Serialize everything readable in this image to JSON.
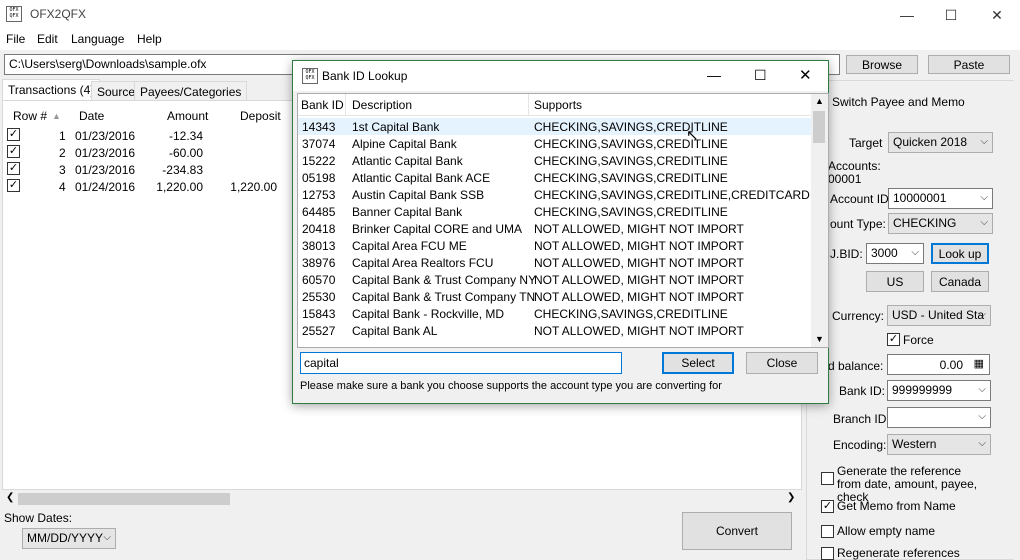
{
  "app": {
    "title": "OFX2QFX",
    "minimize": "—",
    "maximize": "☐",
    "close": "✕"
  },
  "menu": [
    "File",
    "Edit",
    "Language",
    "Help"
  ],
  "path": "C:\\Users\\serg\\Downloads\\sample.ofx",
  "toolbar": {
    "browse": "Browse",
    "paste": "Paste"
  },
  "tabs": [
    "Transactions (4)",
    "Source",
    "Payees/Categories"
  ],
  "grid": {
    "headers": [
      "Row #",
      "Date",
      "Amount",
      "Deposit"
    ],
    "rows": [
      {
        "num": "1",
        "date": "01/23/2016",
        "amount": "-12.34",
        "deposit": ""
      },
      {
        "num": "2",
        "date": "01/23/2016",
        "amount": "-60.00",
        "deposit": ""
      },
      {
        "num": "3",
        "date": "01/23/2016",
        "amount": "-234.83",
        "deposit": ""
      },
      {
        "num": "4",
        "date": "01/24/2016",
        "amount": "1,220.00",
        "deposit": "1,220.00"
      }
    ]
  },
  "bottom": {
    "show_dates_label": "Show Dates:",
    "date_format": "MM/DD/YYYY",
    "convert": "Convert"
  },
  "right": {
    "switch_payee": "Switch Payee and Memo",
    "target_label": "Target",
    "target_value": "Quicken 2018",
    "accounts_label": "Accounts:",
    "accounts_value": "00001",
    "account_id_label": "Account ID:",
    "account_id_value": "10000001",
    "account_type_label": "ount Type:",
    "account_type_value": "CHECKING",
    "intubid_label": "J.BID:",
    "intubid_value": "3000",
    "lookup": "Look up",
    "us": "US",
    "canada": "Canada",
    "currency_label": "Currency:",
    "currency_value": "USD - United Sta",
    "force": "Force",
    "end_balance_label": "d balance:",
    "end_balance_value": "0.00",
    "bank_id_label": "Bank ID:",
    "bank_id_value": "999999999",
    "branch_id_label": "Branch ID",
    "branch_id_value": "",
    "encoding_label": "Encoding:",
    "encoding_value": "Western",
    "gen_ref": "Generate the reference from date, amount, payee, check",
    "get_memo": "Get Memo from Name",
    "allow_empty": "Allow empty name",
    "regen_ref": "Regenerate references"
  },
  "dialog": {
    "title": "Bank ID Lookup",
    "headers": [
      "Bank ID",
      "Description",
      "Supports"
    ],
    "rows": [
      {
        "id": "14343",
        "desc": "1st Capital Bank",
        "supports": "CHECKING,SAVINGS,CREDITLINE"
      },
      {
        "id": "37074",
        "desc": "Alpine Capital Bank",
        "supports": "CHECKING,SAVINGS,CREDITLINE"
      },
      {
        "id": "15222",
        "desc": "Atlantic Capital Bank",
        "supports": "CHECKING,SAVINGS,CREDITLINE"
      },
      {
        "id": "05198",
        "desc": "Atlantic Capital Bank ACE",
        "supports": "CHECKING,SAVINGS,CREDITLINE"
      },
      {
        "id": "12753",
        "desc": "Austin Capital Bank SSB",
        "supports": "CHECKING,SAVINGS,CREDITLINE,CREDITCARD"
      },
      {
        "id": "64485",
        "desc": "Banner Capital Bank",
        "supports": "CHECKING,SAVINGS,CREDITLINE"
      },
      {
        "id": "20418",
        "desc": "Brinker Capital CORE and UMA",
        "supports": "NOT ALLOWED, MIGHT NOT IMPORT"
      },
      {
        "id": "38013",
        "desc": "Capital Area FCU ME",
        "supports": "NOT ALLOWED, MIGHT NOT IMPORT"
      },
      {
        "id": "38976",
        "desc": "Capital Area Realtors FCU",
        "supports": "NOT ALLOWED, MIGHT NOT IMPORT"
      },
      {
        "id": "60570",
        "desc": "Capital Bank & Trust Company NY",
        "supports": "NOT ALLOWED, MIGHT NOT IMPORT"
      },
      {
        "id": "25530",
        "desc": "Capital Bank & Trust Company TN",
        "supports": "NOT ALLOWED, MIGHT NOT IMPORT"
      },
      {
        "id": "15843",
        "desc": "Capital Bank - Rockville, MD",
        "supports": "CHECKING,SAVINGS,CREDITLINE"
      },
      {
        "id": "25527",
        "desc": "Capital Bank AL",
        "supports": "NOT ALLOWED, MIGHT NOT IMPORT"
      }
    ],
    "search_value": "capital",
    "select": "Select",
    "close": "Close",
    "note": "Please make sure a bank you choose supports the account type you are converting for"
  }
}
